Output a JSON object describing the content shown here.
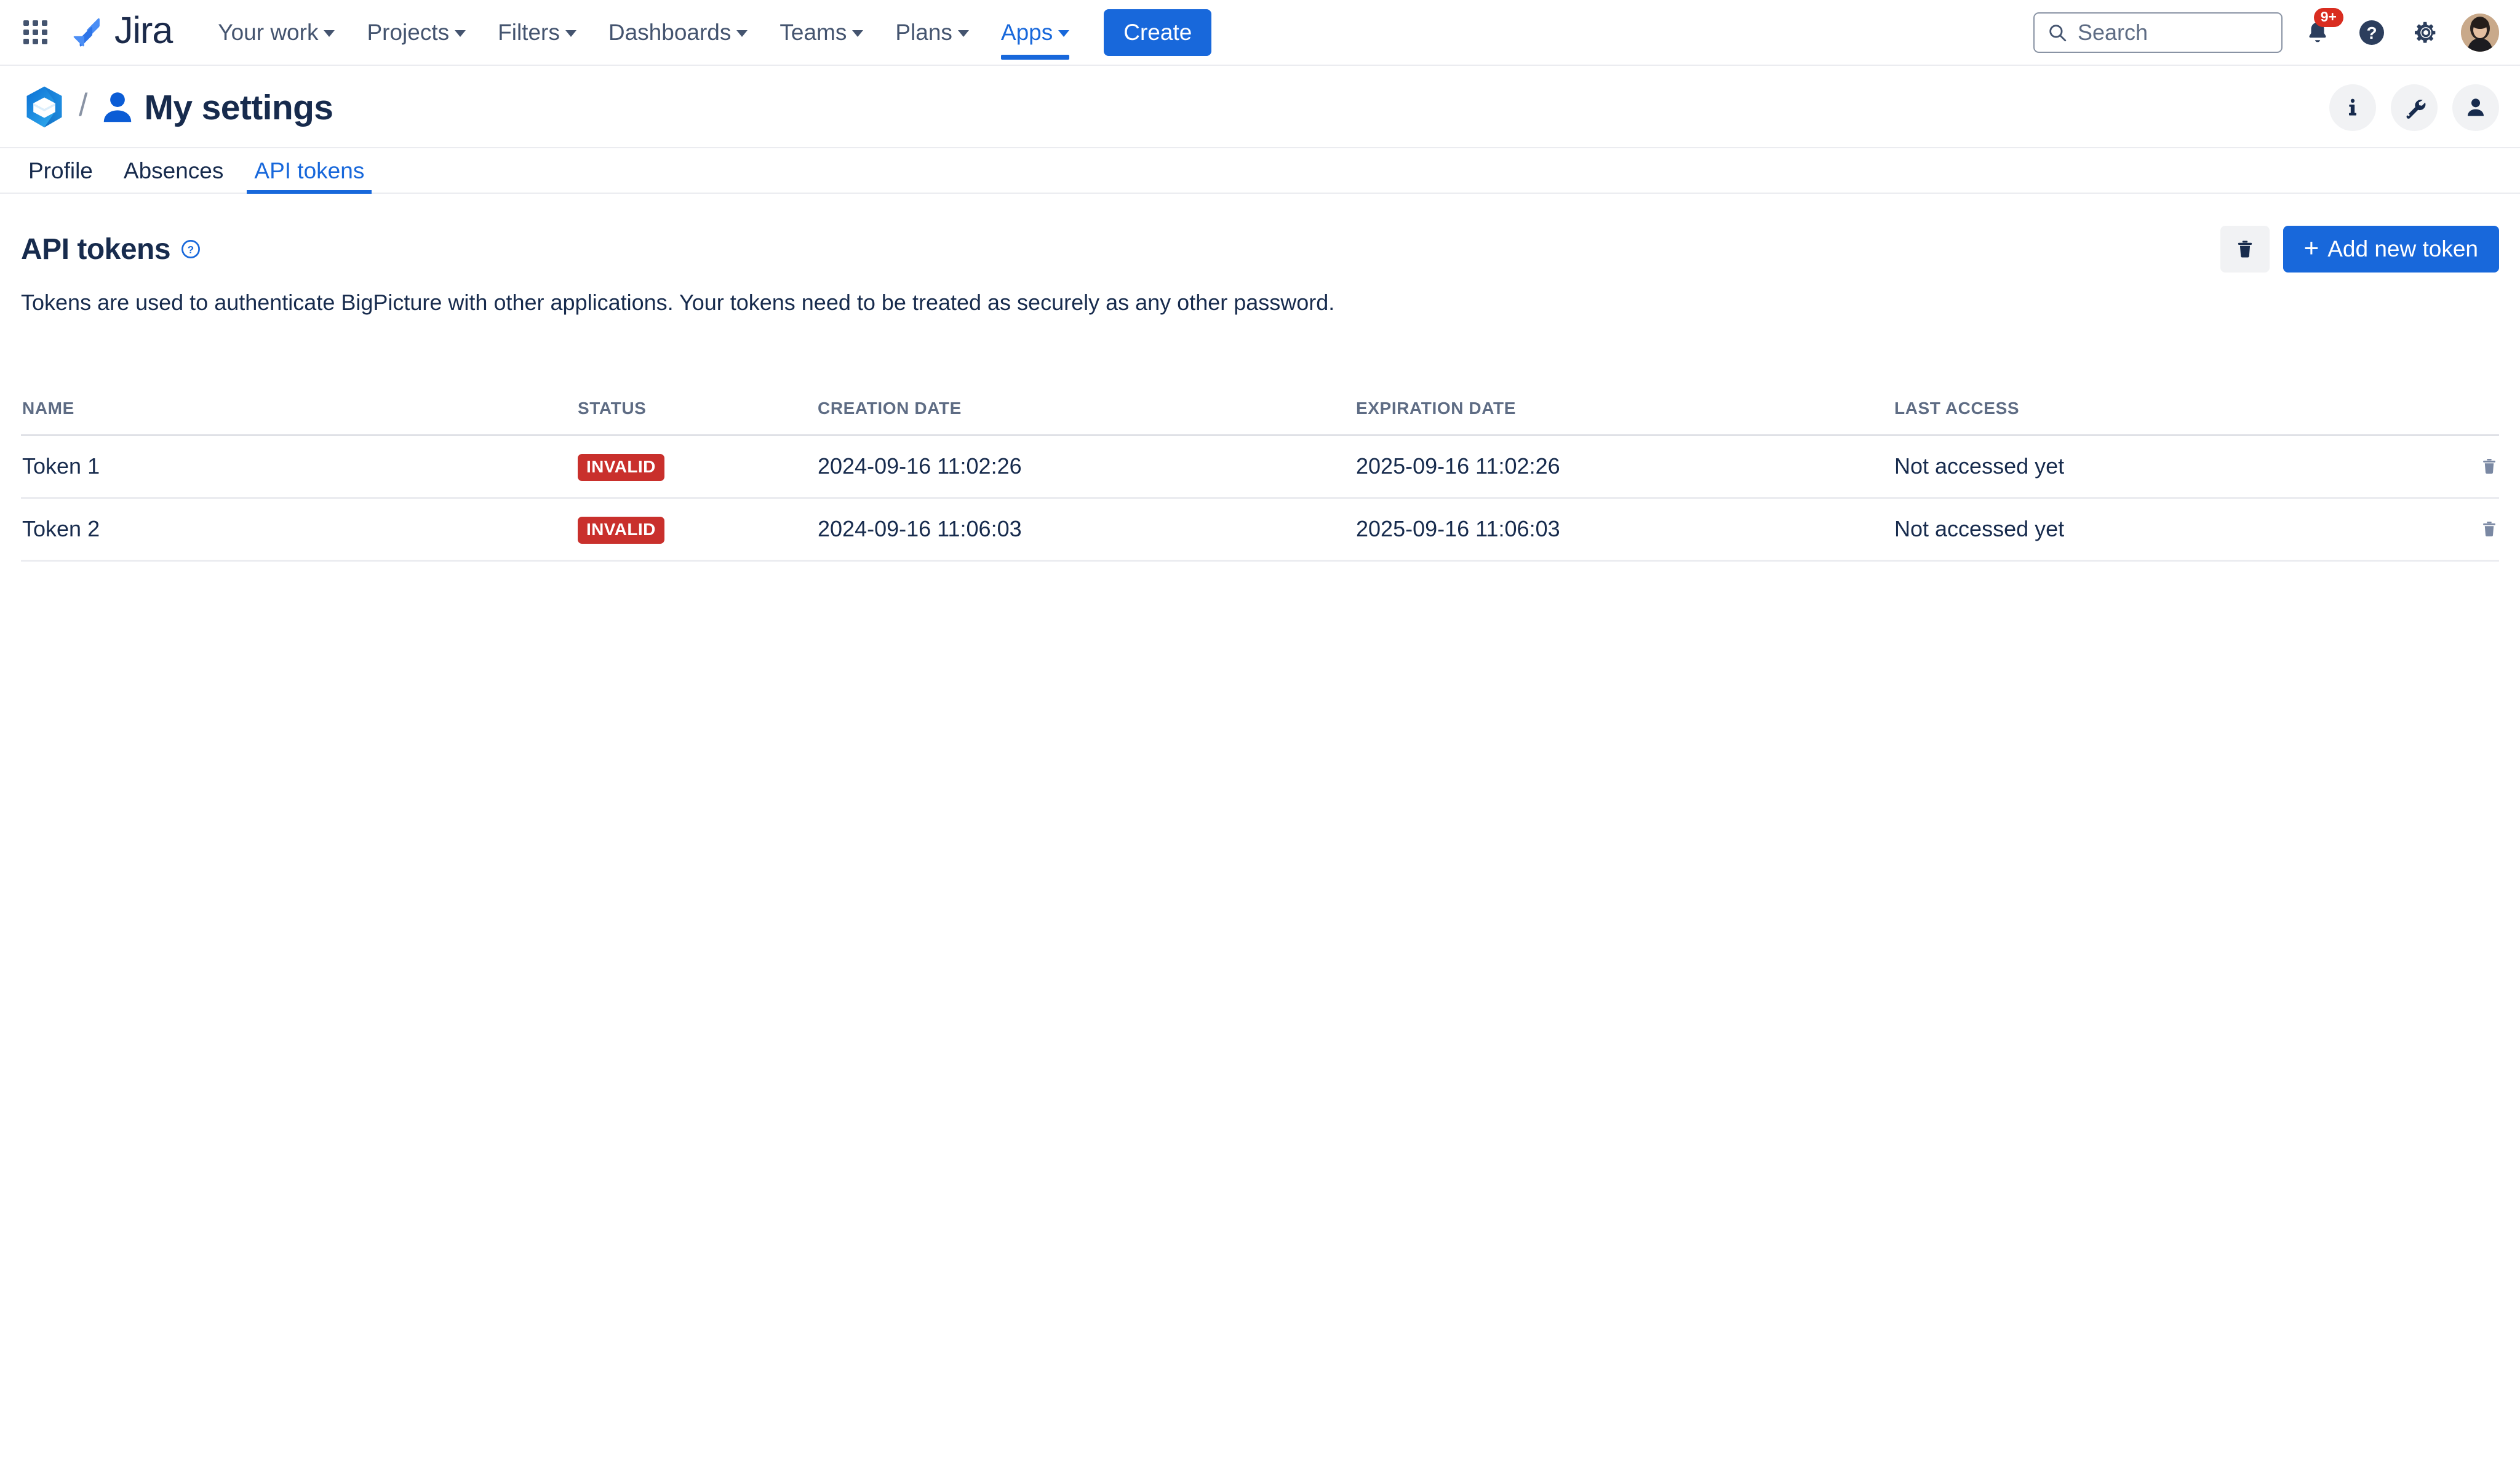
{
  "jira_nav": {
    "app_switcher_icon": "grid-apps-icon",
    "logo_text": "Jira",
    "items": [
      {
        "label": "Your work",
        "has_caret": true,
        "active": false
      },
      {
        "label": "Projects",
        "has_caret": true,
        "active": false
      },
      {
        "label": "Filters",
        "has_caret": true,
        "active": false
      },
      {
        "label": "Dashboards",
        "has_caret": true,
        "active": false
      },
      {
        "label": "Teams",
        "has_caret": true,
        "active": false
      },
      {
        "label": "Plans",
        "has_caret": true,
        "active": false
      },
      {
        "label": "Apps",
        "has_caret": true,
        "active": true
      }
    ],
    "create_label": "Create",
    "search": {
      "placeholder": "Search",
      "value": "",
      "icon": "search-icon"
    },
    "notifications": {
      "icon": "bell-icon",
      "badge_count": "9+",
      "badge_color": "#D92D20"
    },
    "help_icon": "question-circle-icon",
    "settings_icon": "gear-icon",
    "avatar": "user-avatar"
  },
  "page_header": {
    "product_logo": "bigpicture-logo-icon",
    "breadcrumb_separator": "/",
    "title_icon": "person-icon",
    "title": "My settings",
    "actions": [
      {
        "name": "info-button",
        "icon": "info-icon"
      },
      {
        "name": "tools-button",
        "icon": "wrench-icon"
      },
      {
        "name": "account-button",
        "icon": "person-icon"
      }
    ]
  },
  "tabs": [
    {
      "label": "Profile",
      "active": false
    },
    {
      "label": "Absences",
      "active": false
    },
    {
      "label": "API tokens",
      "active": true
    }
  ],
  "section": {
    "title": "API tokens",
    "help_icon": "question-circle-icon",
    "description": "Tokens are used to authenticate BigPicture with other applications. Your tokens need to be treated as securely as any other password.",
    "delete_icon": "trash-icon",
    "add_label": "Add new token",
    "add_plus": "+"
  },
  "table": {
    "columns": [
      "NAME",
      "STATUS",
      "CREATION DATE",
      "EXPIRATION DATE",
      "LAST ACCESS"
    ],
    "rows": [
      {
        "name": "Token 1",
        "status": "INVALID",
        "creation_date": "2024-09-16 11:02:26",
        "expiration_date": "2025-09-16 11:02:26",
        "last_access": "Not accessed yet",
        "delete_icon": "trash-icon"
      },
      {
        "name": "Token 2",
        "status": "INVALID",
        "creation_date": "2024-09-16 11:06:03",
        "expiration_date": "2025-09-16 11:06:03",
        "last_access": "Not accessed yet",
        "delete_icon": "trash-icon"
      }
    ]
  },
  "colors": {
    "brand_blue": "#1868DB",
    "status_invalid": "#C9302C",
    "text_primary": "#172B4D",
    "text_muted": "#5E6C84",
    "border": "#EBECF0",
    "notification_red": "#D92D20"
  }
}
